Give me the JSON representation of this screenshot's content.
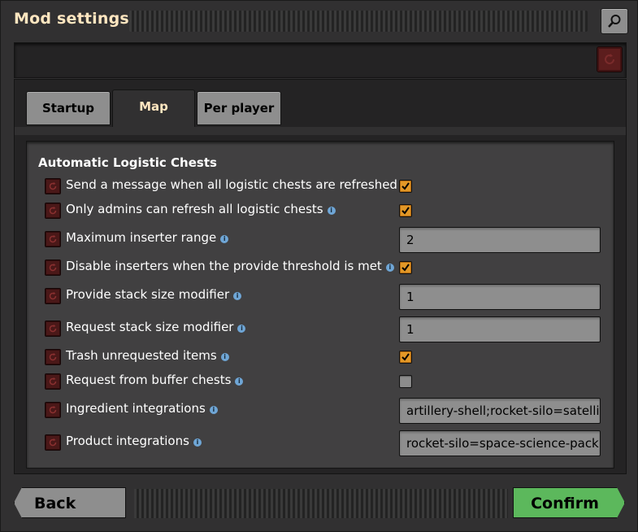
{
  "window": {
    "title": "Mod settings"
  },
  "tabs": [
    {
      "label": "Startup",
      "active": false
    },
    {
      "label": "Map",
      "active": true
    },
    {
      "label": "Per player",
      "active": false
    }
  ],
  "section": {
    "title": "Automatic Logistic Chests"
  },
  "settings": [
    {
      "label": "Send a message when all logistic chests are refreshed",
      "type": "checkbox",
      "checked": true
    },
    {
      "label": "Only admins can refresh all logistic chests",
      "type": "checkbox",
      "checked": true
    },
    {
      "label": "Maximum inserter range",
      "type": "text",
      "value": "2"
    },
    {
      "label": "Disable inserters when the provide threshold is met",
      "type": "checkbox",
      "checked": true
    },
    {
      "label": "Provide stack size modifier",
      "type": "text",
      "value": "1"
    },
    {
      "label": "Request stack size modifier",
      "type": "text",
      "value": "1"
    },
    {
      "label": "Trash unrequested items",
      "type": "checkbox",
      "checked": true
    },
    {
      "label": "Request from buffer chests",
      "type": "checkbox",
      "checked": false
    },
    {
      "label": "Ingredient integrations",
      "type": "text",
      "value": "artillery-shell;rocket-silo=satellite"
    },
    {
      "label": "Product integrations",
      "type": "text",
      "value": "rocket-silo=space-science-pack"
    }
  ],
  "footer": {
    "back_label": "Back",
    "confirm_label": "Confirm"
  },
  "colors": {
    "accent_title": "#ffe6c0",
    "checkbox_on": "#e39827",
    "confirm": "#5cb85c",
    "info_icon": "#6fa6d6"
  },
  "icons": {
    "search": "search-icon",
    "reset": "reset-icon",
    "info": "info-icon",
    "check": "check-icon"
  }
}
